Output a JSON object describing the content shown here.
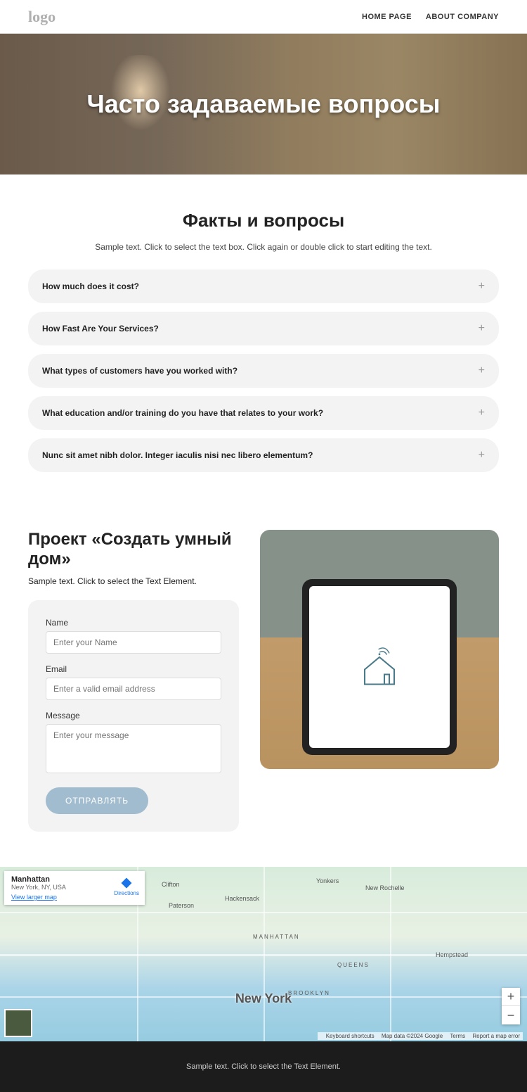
{
  "header": {
    "logo": "logo",
    "nav": [
      "HOME PAGE",
      "ABOUT COMPANY"
    ]
  },
  "hero": {
    "title": "Часто задаваемые вопросы"
  },
  "faq": {
    "heading": "Факты и вопросы",
    "subtitle": "Sample text. Click to select the text box. Click again or double click to start editing the text.",
    "items": [
      "How much does it cost?",
      "How Fast Are Your Services?",
      "What types of customers have you worked with?",
      "What education and/or training do you have that relates to your work?",
      "Nunc sit amet nibh dolor. Integer iaculis nisi nec libero elementum?"
    ]
  },
  "project": {
    "heading": "Проект «Создать умный дом»",
    "subtitle": "Sample text. Click to select the Text Element.",
    "form": {
      "name_label": "Name",
      "name_placeholder": "Enter your Name",
      "email_label": "Email",
      "email_placeholder": "Enter a valid email address",
      "message_label": "Message",
      "message_placeholder": "Enter your message",
      "submit_label": "ОТПРАВЛЯТЬ"
    }
  },
  "map": {
    "card_title": "Manhattan",
    "card_sub": "New York, NY, USA",
    "card_link": "View larger map",
    "directions": "Directions",
    "city": "New York",
    "labels": [
      "Clifton",
      "Paterson",
      "Hackensack",
      "Yonkers",
      "New Rochelle",
      "MANHATTAN",
      "QUEENS",
      "BROOKLYN",
      "Hempstead"
    ],
    "attribution_shortcuts": "Keyboard shortcuts",
    "attribution_data": "Map data ©2024 Google",
    "attribution_terms": "Terms",
    "attribution_report": "Report a map error"
  },
  "footer": {
    "text": "Sample text. Click to select the Text Element."
  }
}
